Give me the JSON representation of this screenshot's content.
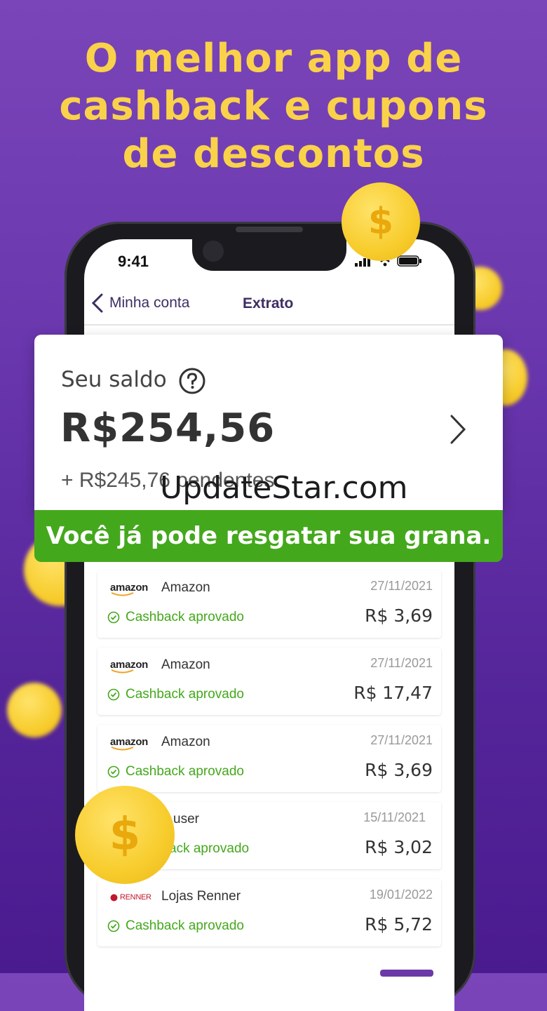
{
  "headline": {
    "line1": "O melhor app de",
    "line2": "cashback e cupons",
    "line3": "de descontos"
  },
  "status_bar": {
    "time": "9:41"
  },
  "nav": {
    "back_label": "Minha conta",
    "title": "Extrato"
  },
  "balance": {
    "label": "Seu saldo",
    "value": "R$254,56",
    "pending": "+ R$245,76 pendentes",
    "banner": "Você já pode resgatar sua grana."
  },
  "watermark": "UpdateStar.com",
  "transactions": [
    {
      "logo": "amazon",
      "store": "Amazon",
      "date": "27/11/2021",
      "status": "Cashback aprovado",
      "amount": "R$ 3,69"
    },
    {
      "logo": "amazon",
      "store": "Amazon",
      "date": "27/11/2021",
      "status": "Cashback aprovado",
      "amount": "R$ 17,47"
    },
    {
      "logo": "amazon",
      "store": "Amazon",
      "date": "27/11/2021",
      "status": "Cashback aprovado",
      "amount": "R$ 3,69"
    },
    {
      "logo": "",
      "store": "user",
      "date": "15/11/2021",
      "status": "ack aprovado",
      "amount": "R$ 3,02"
    },
    {
      "logo": "RENNER",
      "store": "Lojas Renner",
      "date": "19/01/2022",
      "status": "Cashback aprovado",
      "amount": "R$ 5,72"
    }
  ],
  "coins": {
    "symbol": "$"
  },
  "colors": {
    "background": "#6a37ae",
    "headline": "#f9d24a",
    "banner": "#44a81c",
    "approved": "#44a81c"
  }
}
